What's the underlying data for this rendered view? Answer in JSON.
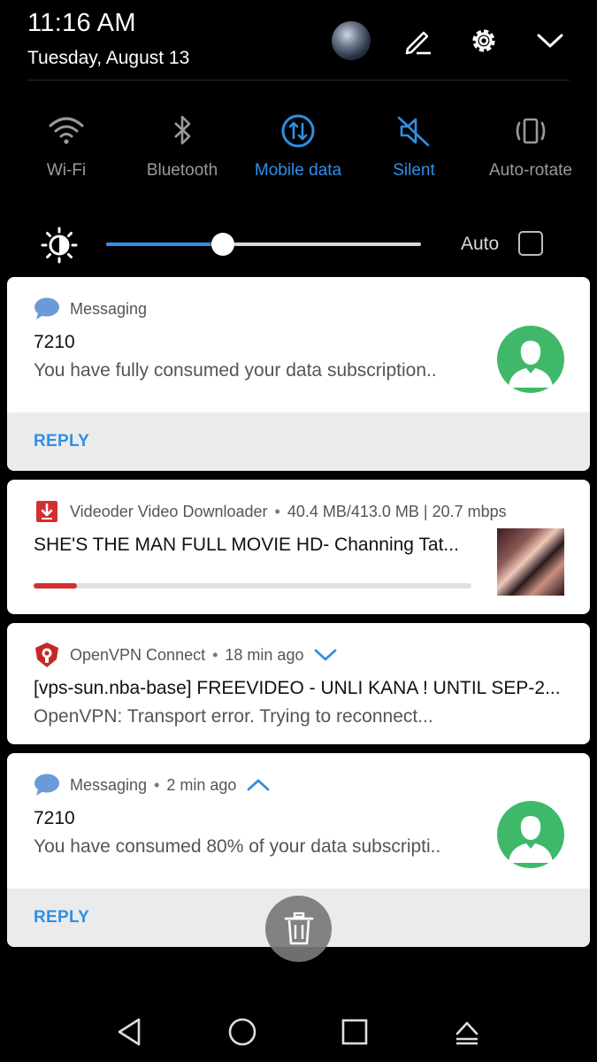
{
  "status": {
    "time": "11:16 AM",
    "date": "Tuesday, August 13"
  },
  "header_icons": [
    "profile-avatar",
    "edit-icon",
    "gear-icon",
    "chevron-down-icon"
  ],
  "toggles": [
    {
      "label": "Wi-Fi",
      "icon": "wifi-icon",
      "active": false
    },
    {
      "label": "Bluetooth",
      "icon": "bluetooth-icon",
      "active": false
    },
    {
      "label": "Mobile data",
      "icon": "mobile-data-icon",
      "active": true
    },
    {
      "label": "Silent",
      "icon": "silent-icon",
      "active": true
    },
    {
      "label": "Auto-rotate",
      "icon": "auto-rotate-icon",
      "active": false
    }
  ],
  "brightness": {
    "level": 0.37,
    "auto_label": "Auto",
    "auto_checked": false
  },
  "notifications": [
    {
      "app": "Messaging",
      "title": "7210",
      "text": "You have fully consumed your data subscription..",
      "action": "REPLY"
    },
    {
      "app": "Videoder Video Downloader",
      "meta": "40.4 MB/413.0 MB | 20.7 mbps",
      "title": "SHE'S THE MAN FULL MOVIE HD- Channing Tat...",
      "progress": 0.098
    },
    {
      "app": "OpenVPN Connect",
      "meta": "18 min ago",
      "title": "[vps-sun.nba-base] FREEVIDEO - UNLI KANA ! UNTIL SEP-2...",
      "text": "OpenVPN: Transport error. Trying to reconnect..."
    },
    {
      "app": "Messaging",
      "meta": "2 min ago",
      "title": "7210",
      "text": "You have consumed 80% of your data subscripti..",
      "action": "REPLY"
    }
  ],
  "colors": {
    "accent": "#2f8fe6",
    "avatar_green": "#3fb969",
    "progress_red": "#d32f2f"
  }
}
